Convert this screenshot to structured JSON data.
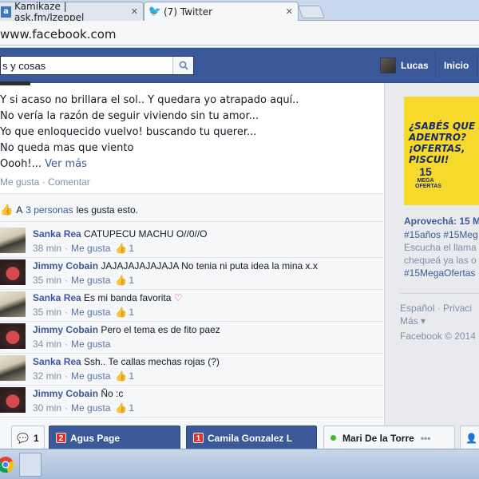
{
  "browser": {
    "tabs": [
      {
        "title": "Kamikaze | ask.fm/lzeppel",
        "favicon": "ask-fm-icon"
      },
      {
        "title": "(7) Twitter",
        "favicon": "twitter-bird-icon"
      }
    ],
    "url": "www.facebook.com"
  },
  "fb_header": {
    "search_value": "s y cosas",
    "user_name": "Lucas",
    "home_label": "Inicio",
    "color": "#3b5998"
  },
  "post": {
    "lines": [
      "Y si acaso no brillara el sol.. Y quedara yo atrapado aquí..",
      "No vería la razón de seguir viviendo sin tu amor...",
      "Yo que enloquecido vuelvo! buscando tu querer...",
      "No queda mas que viento",
      "Oooh!..."
    ],
    "see_more": "Ver más",
    "like_action": "Me gusta",
    "comment_action": "Comentar",
    "separator": "·",
    "likes_prefix": "A",
    "likes_link": "3 personas",
    "likes_suffix": "les gusta esto."
  },
  "comments": [
    {
      "author": "Sanka Rea",
      "text": "CATUPECU MACHU O//0//O",
      "time": "38 min",
      "like_label": "Me gusta",
      "likes": "1",
      "avatar": "sanka"
    },
    {
      "author": "Jimmy Cobain",
      "text": "JAJAJAJAJAJAJA No tenia ni puta idea la mina x.x",
      "time": "35 min",
      "like_label": "Me gusta",
      "likes": "1",
      "avatar": "jimmy"
    },
    {
      "author": "Sanka Rea",
      "text": "Es mi banda favorita",
      "emoji": "♡",
      "time": "35 min",
      "like_label": "Me gusta",
      "likes": "1",
      "avatar": "sanka"
    },
    {
      "author": "Jimmy Cobain",
      "text": "Pero el tema es de fito paez",
      "time": "34 min",
      "like_label": "Me gusta",
      "likes": "",
      "avatar": "jimmy"
    },
    {
      "author": "Sanka Rea",
      "text": "Ssh.. Te callas mechas rojas (?)",
      "time": "32 min",
      "like_label": "Me gusta",
      "likes": "1",
      "avatar": "sanka"
    },
    {
      "author": "Jimmy Cobain",
      "text": "Ño :c",
      "time": "30 min",
      "like_label": "Me gusta",
      "likes": "1",
      "avatar": "jimmy"
    }
  ],
  "rail": {
    "ad_lines": [
      "¿SABÉS QUE H",
      "ADENTRO?",
      "¡OFERTAS,",
      "PISCUI!"
    ],
    "ad_badge_number": "15",
    "ad_badge_text": "MEGA OFERTAS",
    "ad_title": "Aprovechá: 15 M",
    "ad_text": [
      {
        "text": "#15años #15Meg",
        "style": "link"
      },
      {
        "text": "Escucha el llama",
        "style": "grey"
      },
      {
        "text": "chequeá ya las o",
        "style": "grey"
      },
      {
        "text": "#15MegaOfertas",
        "style": "link"
      }
    ],
    "footer_line1": "Español · Privaci",
    "footer_line2": "Más ▾",
    "footer_line3": "Facebook © 2014"
  },
  "chat": {
    "notif_count": "1",
    "tabs": [
      {
        "name": "Agus Page",
        "count": "2",
        "style": "blue"
      },
      {
        "name": "Camila Gonzalez L",
        "count": "1",
        "style": "blue"
      },
      {
        "name": "Mari De la Torre",
        "status": "online",
        "style": "white"
      }
    ]
  }
}
